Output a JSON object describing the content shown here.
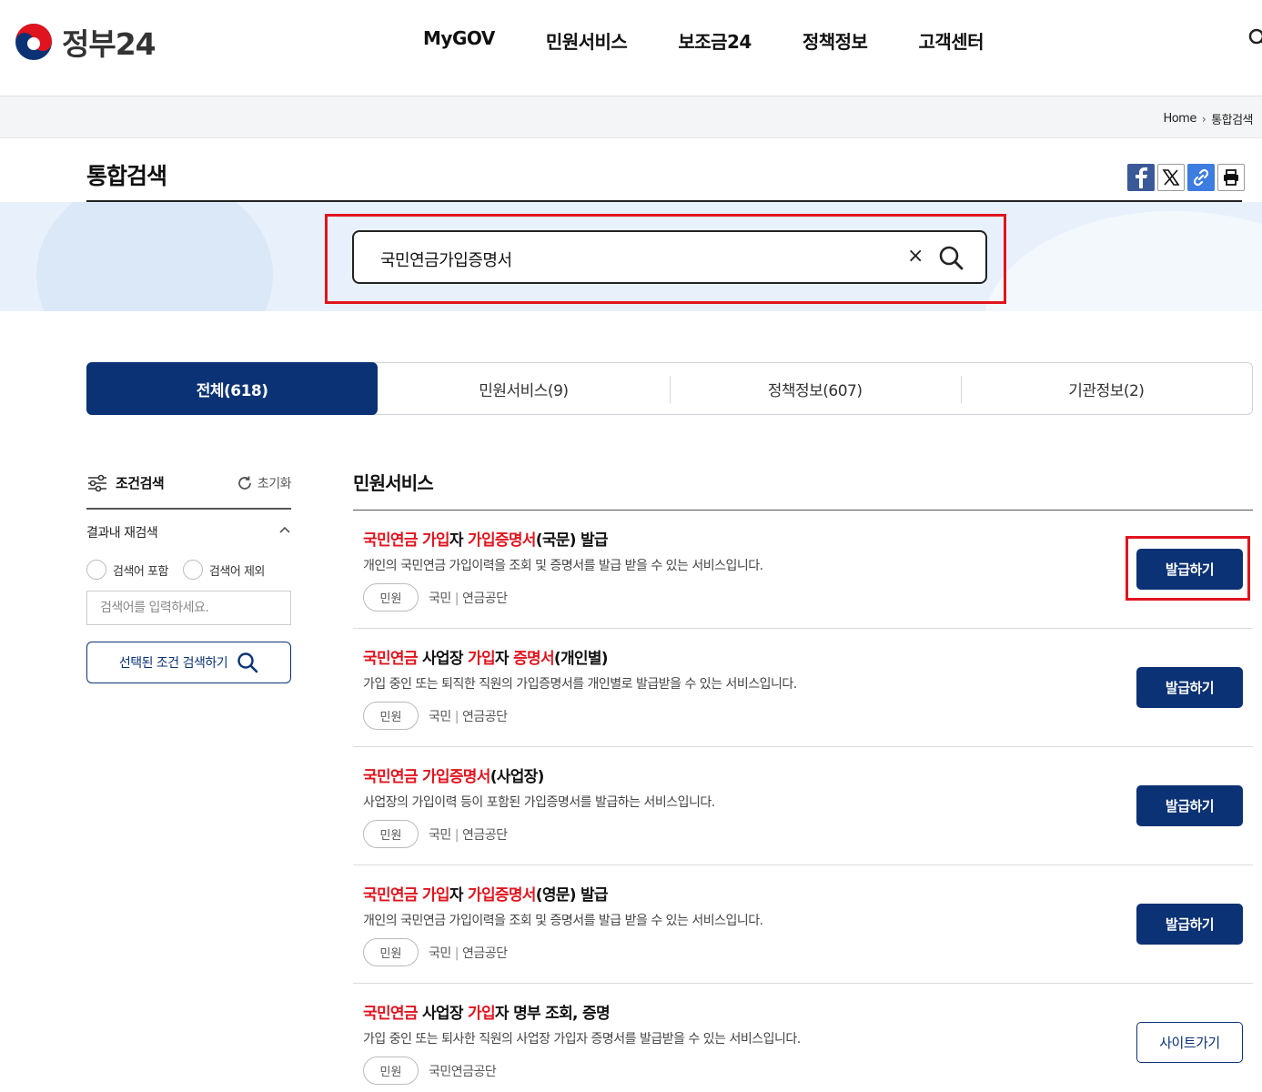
{
  "header": {
    "logo_text": "정부24",
    "nav": [
      "MyGOV",
      "민원서비스",
      "보조금24",
      "정책정보",
      "고객센터"
    ]
  },
  "breadcrumb": {
    "home": "Home",
    "current": "통합검색"
  },
  "page": {
    "title": "통합검색"
  },
  "search": {
    "value": "국민연금가입증명서",
    "clear": "×"
  },
  "tabs": [
    {
      "label": "전체(618)",
      "active": true
    },
    {
      "label": "민원서비스(9)",
      "active": false
    },
    {
      "label": "정책정보(607)",
      "active": false
    },
    {
      "label": "기관정보(2)",
      "active": false
    }
  ],
  "filter": {
    "title": "조건검색",
    "reset": "초기화",
    "refine_label": "결과내 재검색",
    "include": "검색어 포함",
    "exclude": "검색어 제외",
    "placeholder": "검색어를 입력하세요.",
    "submit": "선택된 조건 검색하기"
  },
  "results_section": {
    "title": "민원서비스"
  },
  "results": [
    {
      "title_parts": [
        {
          "t": "국민연금",
          "hl": true
        },
        {
          "t": " ",
          "hl": false
        },
        {
          "t": "가입",
          "hl": true
        },
        {
          "t": "자 ",
          "hl": false
        },
        {
          "t": "가입증명서",
          "hl": true
        },
        {
          "t": "(국문) 발급",
          "hl": false
        }
      ],
      "desc": "개인의 국민연금 가입이력을 조회 및 증명서를 발급 받을 수 있는 서비스입니다.",
      "badge": "민원",
      "org": [
        "국민",
        "연금공단"
      ],
      "button": "발급하기",
      "button_style": "filled"
    },
    {
      "title_parts": [
        {
          "t": "국민연금",
          "hl": true
        },
        {
          "t": " 사업장 ",
          "hl": false
        },
        {
          "t": "가입",
          "hl": true
        },
        {
          "t": "자 ",
          "hl": false
        },
        {
          "t": "증명서",
          "hl": true
        },
        {
          "t": "(개인별)",
          "hl": false
        }
      ],
      "desc": "가입 중인 또는 퇴직한 직원의 가입증명서를 개인별로 발급받을 수 있는 서비스입니다.",
      "badge": "민원",
      "org": [
        "국민",
        "연금공단"
      ],
      "button": "발급하기",
      "button_style": "filled"
    },
    {
      "title_parts": [
        {
          "t": "국민연금",
          "hl": true
        },
        {
          "t": " ",
          "hl": false
        },
        {
          "t": "가입증명서",
          "hl": true
        },
        {
          "t": "(사업장)",
          "hl": false
        }
      ],
      "desc": "사업장의 가입이력 등이 포함된 가입증명서를 발급하는 서비스입니다.",
      "badge": "민원",
      "org": [
        "국민",
        "연금공단"
      ],
      "button": "발급하기",
      "button_style": "filled"
    },
    {
      "title_parts": [
        {
          "t": "국민연금",
          "hl": true
        },
        {
          "t": " ",
          "hl": false
        },
        {
          "t": "가입",
          "hl": true
        },
        {
          "t": "자 ",
          "hl": false
        },
        {
          "t": "가입증명서",
          "hl": true
        },
        {
          "t": "(영문) 발급",
          "hl": false
        }
      ],
      "desc": "개인의 국민연금 가입이력을 조회 및 증명서를 발급 받을 수 있는 서비스입니다.",
      "badge": "민원",
      "org": [
        "국민",
        "연금공단"
      ],
      "button": "발급하기",
      "button_style": "filled"
    },
    {
      "title_parts": [
        {
          "t": "국민연금",
          "hl": true
        },
        {
          "t": " 사업장 ",
          "hl": false
        },
        {
          "t": "가입",
          "hl": true
        },
        {
          "t": "자 명부 조회, 증명",
          "hl": false
        }
      ],
      "desc": "가입 중인 또는 퇴사한 직원의 사업장 가입자 증명서를 발급받을 수 있는 서비스입니다.",
      "badge": "민원",
      "org": [
        "국민연금공단"
      ],
      "button": "사이트가기",
      "button_style": "outline"
    }
  ],
  "colors": {
    "navy": "#0b3274",
    "highlight": "#e0141e",
    "banner": "#e8f1fb"
  },
  "icons": {
    "logo": "taegeuk-logo-icon",
    "search": "magnifier-icon",
    "clear": "close-icon",
    "facebook": "facebook-icon",
    "x": "x-icon",
    "link": "link-icon",
    "print": "print-icon",
    "filter": "sliders-icon",
    "reset": "refresh-icon",
    "collapse": "chevron-up-icon"
  }
}
